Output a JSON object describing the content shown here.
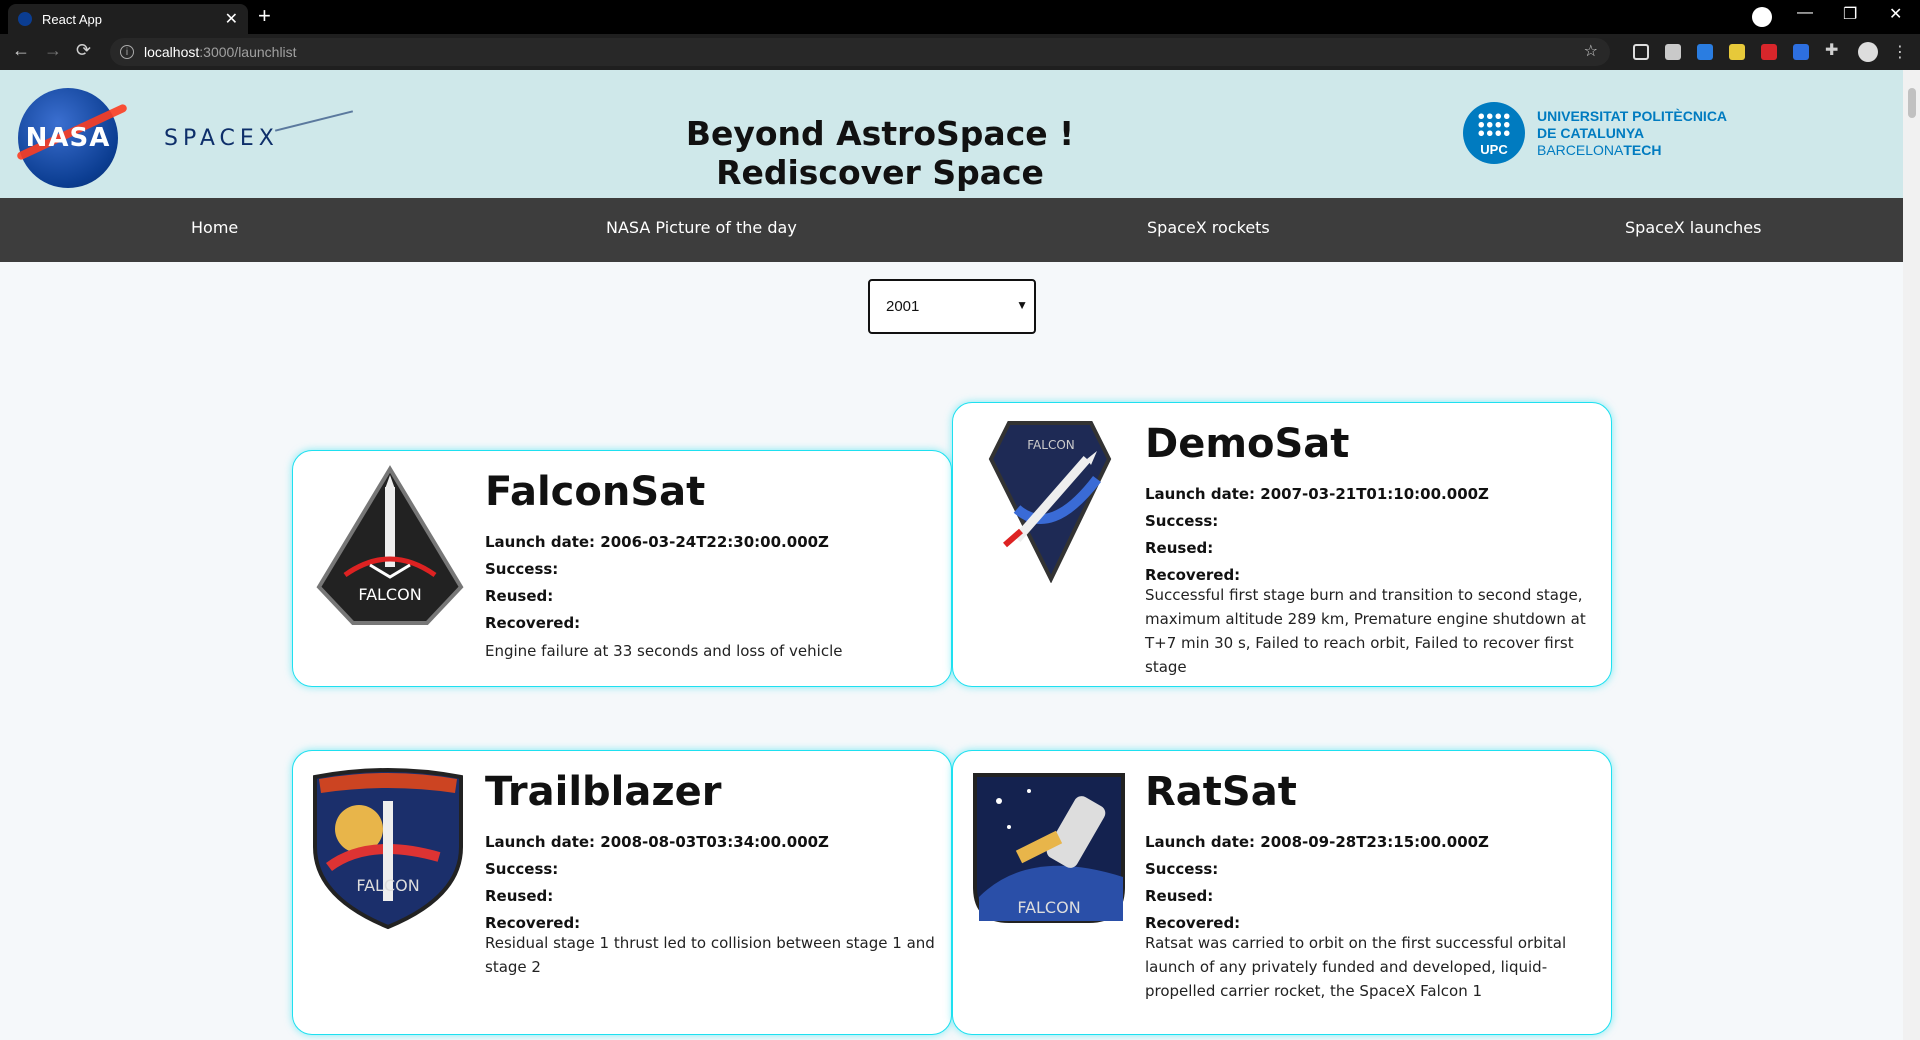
{
  "browser": {
    "tab_title": "React App",
    "url_host": "localhost",
    "url_path": ":3000/launchlist"
  },
  "header": {
    "nasa_logo_text": "NASA",
    "spacex_logo_text": "SPACEX",
    "title": "Beyond AstroSpace ! Rediscover Space",
    "upc_badge": "UPC",
    "upc_line1": "UNIVERSITAT POLITÈCNICA",
    "upc_line2": "DE CATALUNYA",
    "upc_line3_a": "BARCELONA",
    "upc_line3_b": "TECH"
  },
  "nav": {
    "home": "Home",
    "apod": "NASA Picture of the day",
    "rockets": "SpaceX rockets",
    "launches": "SpaceX launches"
  },
  "filter": {
    "year": "2001"
  },
  "launches": [
    {
      "name": "FalconSat",
      "launch_date": "Launch date: 2006-03-24T22:30:00.000Z",
      "success": "Success:",
      "reused": "Reused:",
      "recovered": "Recovered:",
      "details": "Engine failure at 33 seconds and loss of vehicle",
      "patch_text": "FALCON"
    },
    {
      "name": "DemoSat",
      "launch_date": "Launch date: 2007-03-21T01:10:00.000Z",
      "success": "Success:",
      "reused": "Reused:",
      "recovered": "Recovered:",
      "details": "Successful first stage burn and transition to second stage, maximum altitude 289 km, Premature engine shutdown at T+7 min 30 s, Failed to reach orbit, Failed to recover first stage",
      "patch_text": "FALCON"
    },
    {
      "name": "Trailblazer",
      "launch_date": "Launch date: 2008-08-03T03:34:00.000Z",
      "success": "Success:",
      "reused": "Reused:",
      "recovered": "Recovered:",
      "details": "Residual stage 1 thrust led to collision between stage 1 and stage 2",
      "patch_text": "FALCON"
    },
    {
      "name": "RatSat",
      "launch_date": "Launch date: 2008-09-28T23:15:00.000Z",
      "success": "Success:",
      "reused": "Reused:",
      "recovered": "Recovered:",
      "details": "Ratsat was carried to orbit on the first successful orbital launch of any privately funded and developed, liquid-propelled carrier rocket, the SpaceX Falcon 1",
      "patch_text": "FALCON"
    }
  ]
}
